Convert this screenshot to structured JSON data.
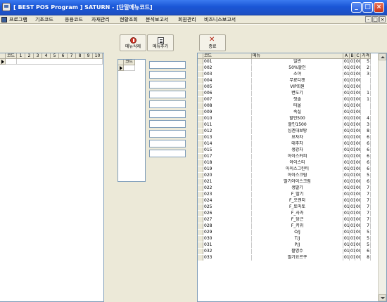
{
  "window": {
    "title": "[ BEST POS Program ]  SATURN  - [단말메뉴코드]",
    "min": "_",
    "max": "□",
    "close": "×"
  },
  "menubar": {
    "items": [
      "프로그램",
      "기초코드",
      "응용코드",
      "자재관리",
      "현황조회",
      "분석보고서",
      "회원관리",
      "비즈니스보고서"
    ],
    "mdi_min": "-",
    "mdi_max": "□",
    "mdi_close": "×"
  },
  "toolbar": {
    "delete_label": "메뉴삭제",
    "add_label": "메뉴추가",
    "close_label": "종료"
  },
  "left_grid": {
    "headers": [
      "코드",
      "1",
      "2",
      "3",
      "4",
      "5",
      "6",
      "7",
      "8",
      "9",
      "10"
    ]
  },
  "mid_grid": {
    "header": "코드"
  },
  "menu_grid": {
    "headers": [
      "코드",
      "메뉴",
      "A",
      "B",
      "C",
      "가격"
    ],
    "rows": [
      [
        "001",
        "일반",
        "01",
        "01",
        "00",
        "5"
      ],
      [
        "002",
        "50%할인",
        "01",
        "01",
        "00",
        "2"
      ],
      [
        "003",
        "소야",
        "01",
        "01",
        "00",
        "3"
      ],
      [
        "004",
        "무료디켓",
        "01",
        "01",
        "00",
        ""
      ],
      [
        "005",
        "VIP회원",
        "01",
        "01",
        "00",
        ""
      ],
      [
        "006",
        "변도기",
        "01",
        "01",
        "00",
        "1"
      ],
      [
        "007",
        "첫솔",
        "01",
        "01",
        "00",
        "1"
      ],
      [
        "008",
        "타올",
        "01",
        "01",
        "00",
        ""
      ],
      [
        "009",
        "속실",
        "01",
        "01",
        "00",
        ""
      ],
      [
        "010",
        "할인500",
        "01",
        "01",
        "00",
        "4"
      ],
      [
        "011",
        "할인1500",
        "01",
        "01",
        "00",
        "3"
      ],
      [
        "012",
        "심겐대보탕",
        "01",
        "01",
        "00",
        "8"
      ],
      [
        "013",
        "요자차",
        "01",
        "01",
        "00",
        "6"
      ],
      [
        "014",
        "대추차",
        "01",
        "01",
        "00",
        "6"
      ],
      [
        "015",
        "생강차",
        "01",
        "01",
        "00",
        "6"
      ],
      [
        "017",
        "아이스커피",
        "01",
        "01",
        "00",
        "6"
      ],
      [
        "018",
        "아이스티",
        "01",
        "01",
        "00",
        "6"
      ],
      [
        "019",
        "아이스그린티",
        "01",
        "01",
        "00",
        "6"
      ],
      [
        "020",
        "아이스크림",
        "01",
        "01",
        "00",
        "5"
      ],
      [
        "021",
        "딸기아이스크림",
        "01",
        "01",
        "00",
        "6"
      ],
      [
        "022",
        "생딸기",
        "01",
        "01",
        "00",
        "7"
      ],
      [
        "023",
        "F_딸기",
        "01",
        "01",
        "00",
        "7"
      ],
      [
        "024",
        "F_오렌지",
        "01",
        "01",
        "00",
        "7"
      ],
      [
        "025",
        "F_토마토",
        "01",
        "01",
        "00",
        "7"
      ],
      [
        "026",
        "F_사과",
        "01",
        "01",
        "00",
        "7"
      ],
      [
        "027",
        "F_당근",
        "01",
        "01",
        "00",
        "7"
      ],
      [
        "028",
        "F_키위",
        "01",
        "01",
        "00",
        "7"
      ],
      [
        "029",
        "O/J",
        "01",
        "01",
        "00",
        "5"
      ],
      [
        "030",
        "T/J",
        "01",
        "01",
        "00",
        "5"
      ],
      [
        "031",
        "P/J",
        "01",
        "01",
        "00",
        "5"
      ],
      [
        "032",
        "활명수",
        "01",
        "01",
        "00",
        "6"
      ],
      [
        "033",
        "딸기요르쿠",
        "01",
        "01",
        "00",
        "8"
      ]
    ]
  }
}
